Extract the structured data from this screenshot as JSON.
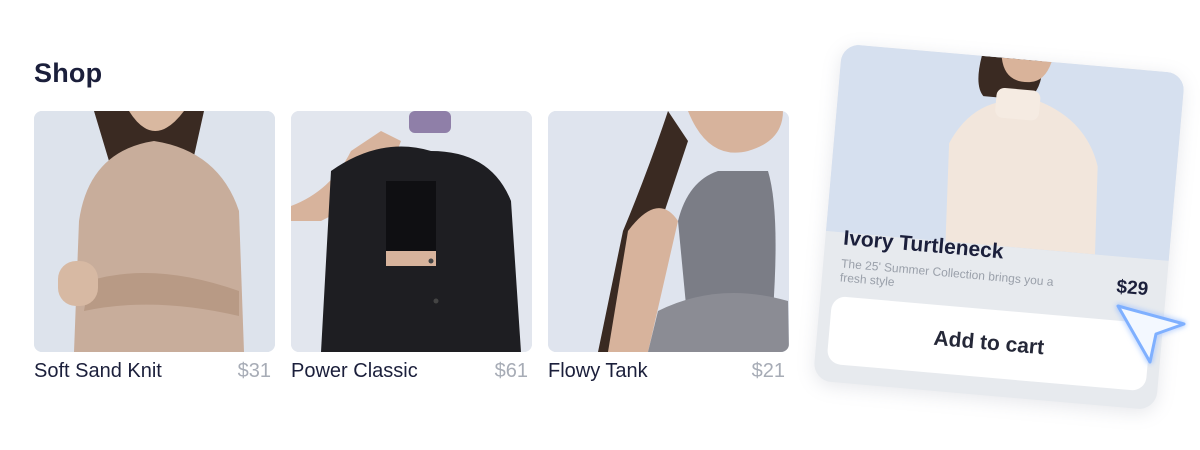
{
  "shop": {
    "title": "Shop"
  },
  "products": [
    {
      "name": "Soft Sand Knit",
      "price": "$31"
    },
    {
      "name": "Power Classic",
      "price": "$61"
    },
    {
      "name": "Flowy Tank",
      "price": "$21"
    }
  ],
  "featured": {
    "name": "Ivory Turtleneck",
    "description": "The 25' Summer Collection brings you a fresh style",
    "price": "$29",
    "add_to_cart_label": "Add to cart"
  },
  "colors": {
    "title": "#1b1f3b",
    "price_muted": "#a7acb6",
    "card_bg": "#e7eaee",
    "cursor_accent": "#7fb0ff"
  },
  "icons": {
    "cursor": "pointer-cursor-icon"
  }
}
